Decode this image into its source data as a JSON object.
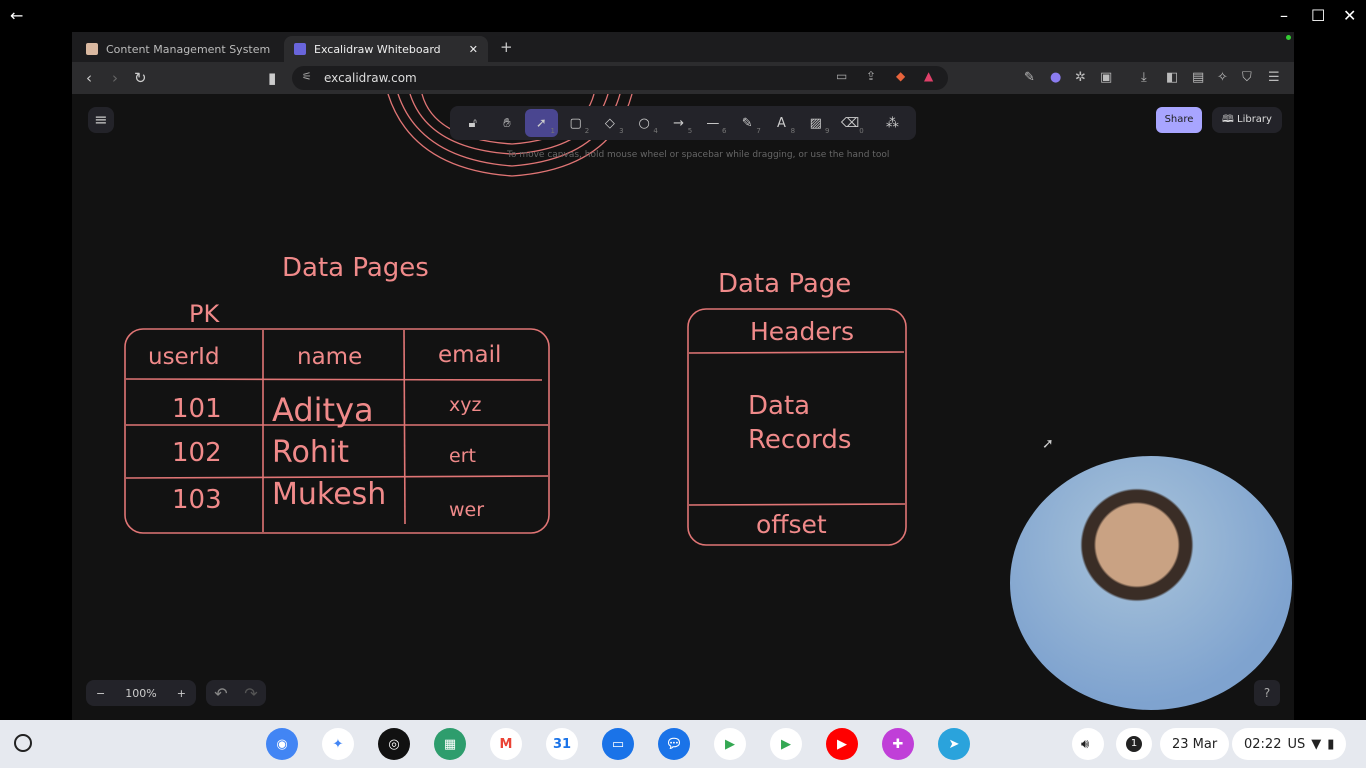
{
  "os": {
    "back_icon": "arrow-left-icon",
    "controls": [
      "minimize-icon",
      "maximize-icon",
      "close-icon"
    ]
  },
  "browser": {
    "tabs": [
      {
        "title": "Content Management System",
        "active": false
      },
      {
        "title": "Excalidraw Whiteboard",
        "active": true
      }
    ],
    "url": "excalidraw.com"
  },
  "excalidraw": {
    "tools": [
      {
        "name": "lock",
        "key": ""
      },
      {
        "name": "hand",
        "key": ""
      },
      {
        "name": "selection",
        "key": "1",
        "active": true
      },
      {
        "name": "rectangle",
        "key": "2"
      },
      {
        "name": "diamond",
        "key": "3"
      },
      {
        "name": "ellipse",
        "key": "4"
      },
      {
        "name": "arrow",
        "key": "5"
      },
      {
        "name": "line",
        "key": "6"
      },
      {
        "name": "draw",
        "key": "7"
      },
      {
        "name": "text",
        "key": "8"
      },
      {
        "name": "image",
        "key": "9"
      },
      {
        "name": "eraser",
        "key": "0"
      },
      {
        "name": "extra-tools",
        "key": ""
      }
    ],
    "hint": "To move canvas, hold mouse wheel or spacebar while dragging, or use the hand tool",
    "share_label": "Share",
    "library_label": "Library",
    "zoom": "100%",
    "accent": "#a8a5ff",
    "ink_color": "#f08a8a"
  },
  "drawing": {
    "left_title": "Data Pages",
    "pk_label": "PK",
    "table": {
      "headers": [
        "userId",
        "name",
        "email"
      ],
      "rows": [
        [
          "101",
          "Aditya",
          "xyz"
        ],
        [
          "102",
          "Rohit",
          "ert"
        ],
        [
          "103",
          "Mukesh",
          "wer"
        ]
      ]
    },
    "right_title": "Data Page",
    "box": {
      "top": "Headers",
      "middle": [
        "Data",
        "Records"
      ],
      "bottom": "offset"
    }
  },
  "taskbar": {
    "apps": [
      "Chrome",
      "Gemini",
      "Podcasts",
      "Apps",
      "Gmail",
      "Calendar",
      "Files",
      "Messages",
      "Meet",
      "Play Store",
      "YouTube",
      "Canva",
      "Telegram"
    ],
    "notification_count": "1",
    "date": "23 Mar",
    "time": "02:22",
    "locale": "US"
  }
}
